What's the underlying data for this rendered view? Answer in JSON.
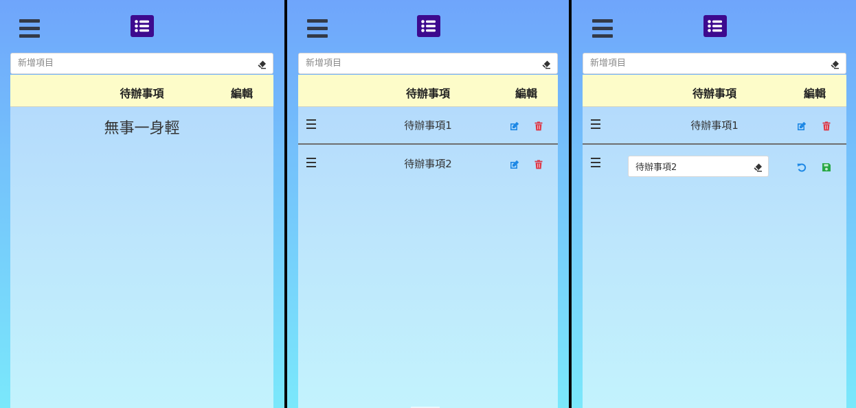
{
  "screens": [
    {
      "new_item": {
        "placeholder": "新增項目"
      },
      "header": {
        "title": "待辦事項",
        "edit_label": "編輯"
      },
      "empty_message": "無事一身輕",
      "items": []
    },
    {
      "new_item": {
        "placeholder": "新增項目"
      },
      "header": {
        "title": "待辦事項",
        "edit_label": "編輯"
      },
      "items": [
        {
          "text": "待辦事項1"
        },
        {
          "text": "待辦事項2"
        }
      ]
    },
    {
      "new_item": {
        "placeholder": "新增項目"
      },
      "header": {
        "title": "待辦事項",
        "edit_label": "編輯"
      },
      "items": [
        {
          "text": "待辦事項1"
        },
        {
          "text": "待辦事項2",
          "editing": true,
          "edit_value": "待辦事項2"
        }
      ]
    }
  ],
  "icons": {
    "menu": "hamburger-menu-icon",
    "logo": "list-icon",
    "clear": "eraser-icon",
    "drag": "drag-handle-icon",
    "edit": "edit-icon",
    "delete": "trash-icon",
    "undo": "undo-icon",
    "save": "save-icon"
  },
  "colors": {
    "logo_bg": "#3d0a8e",
    "header_bg": "#fdfcc9",
    "edit_icon": "#1e88e5",
    "delete_icon": "#dc3545",
    "undo_icon": "#1e88e5",
    "save_icon": "#28a745"
  }
}
